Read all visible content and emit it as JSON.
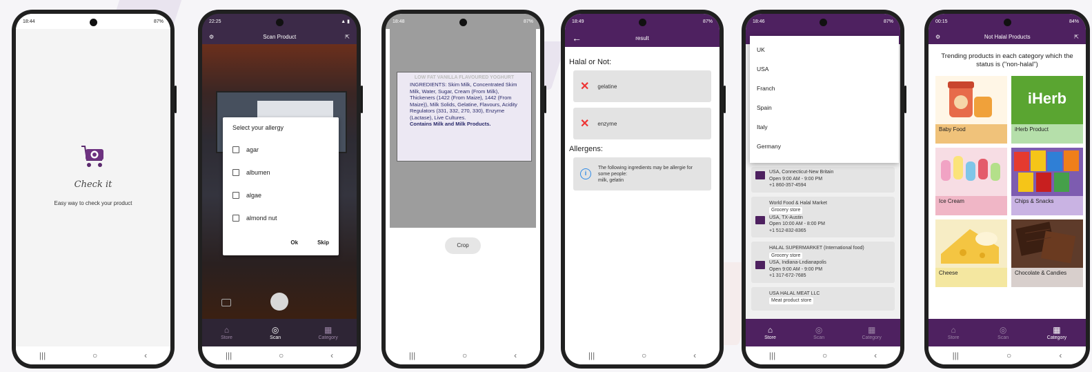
{
  "screen1": {
    "status_time": "18:44",
    "status_right": "87%",
    "brand": "Check it",
    "tagline": "Easy way to check your product"
  },
  "screen2": {
    "status_time": "22:25",
    "title": "Scan Product",
    "dialog_title": "Select your allergy",
    "options": [
      "agar",
      "albumen",
      "algae",
      "almond nut"
    ],
    "ok": "Ok",
    "skip": "Skip",
    "tabs": [
      "Store",
      "Scan",
      "Category"
    ],
    "active_tab": "Scan"
  },
  "screen3": {
    "status_time": "18:48",
    "status_right": "87%",
    "label_title": "LOW FAT VANILLA FLAVOURED YOGHURT",
    "label_body_1": "INGREDIENTS: Skim Milk, Concentrated Skim Milk, Water, Sugar, Cream (From Milk), Thickeners (1422 (From Maize), 1442 (From Maize)), Milk Solids, Gelatine, Flavours, Acidity Regulators (331, 332, 270, 330), Enzyme (Lactase), Live Cultures.",
    "label_body_2": "Contains Milk and Milk Products.",
    "crop": "Crop"
  },
  "screen4": {
    "status_time": "18:49",
    "status_right": "87%",
    "title": "result",
    "halal_heading": "Halal or Not:",
    "results": [
      "gelatine",
      "enzyme"
    ],
    "allergens_heading": "Allergens:",
    "allergen_text": "The following ingredients may be allergie for some people:",
    "allergen_items": "milk, gelatin"
  },
  "screen5": {
    "status_time": "18:46",
    "status_right": "87%",
    "countries": [
      "UK",
      "USA",
      "Franch",
      "Spain",
      "Italy",
      "Germany"
    ],
    "stores": [
      {
        "name": "",
        "type": "",
        "location": "USA, Connecticut-New Britain",
        "hours": "Open 9:00 AM - 9:00 PM",
        "phone": "+1 860-357-4594"
      },
      {
        "name": "World Food & Halal Market",
        "type": "Grocery store",
        "location": "USA, TX-Austin",
        "hours": "Open 10:00 AM - 8:00 PM",
        "phone": "+1 512-832-8365"
      },
      {
        "name": "HALAL SUPERMARKET (International food)",
        "type": "Grocery store",
        "location": "USA, Indiana-Lndianapolis",
        "hours": "Open 9:00 AM - 9:00 PM",
        "phone": "+1 317-672-7685"
      },
      {
        "name": "USA HALAL MEAT LLC",
        "type": "Meat product store",
        "location": "",
        "hours": "",
        "phone": ""
      }
    ],
    "tabs": [
      "Store",
      "Scan",
      "Category"
    ],
    "active_tab": "Store"
  },
  "screen6": {
    "status_time": "00:15",
    "status_right": "84%",
    "title": "Not Halal Products",
    "trend": "Trending products in each category which the status is (\"non-halal\")",
    "categories": [
      "Baby Food",
      "iHerb Product",
      "Ice Cream",
      "Chips & Snacks",
      "Cheese",
      "Chocolate & Candies"
    ],
    "iherb_logo": "iHerb",
    "tabs": [
      "Store",
      "Scan",
      "Category"
    ],
    "active_tab": "Category"
  },
  "colors": {
    "brand_purple": "#4e2160",
    "error_red": "#e33333",
    "info_blue": "#2e8ae6"
  },
  "icons": [
    "camera-cart-icon",
    "settings-gear-icon",
    "back-arrow-icon",
    "close-x-icon",
    "info-icon",
    "store-icon",
    "scan-icon",
    "category-grid-icon"
  ]
}
